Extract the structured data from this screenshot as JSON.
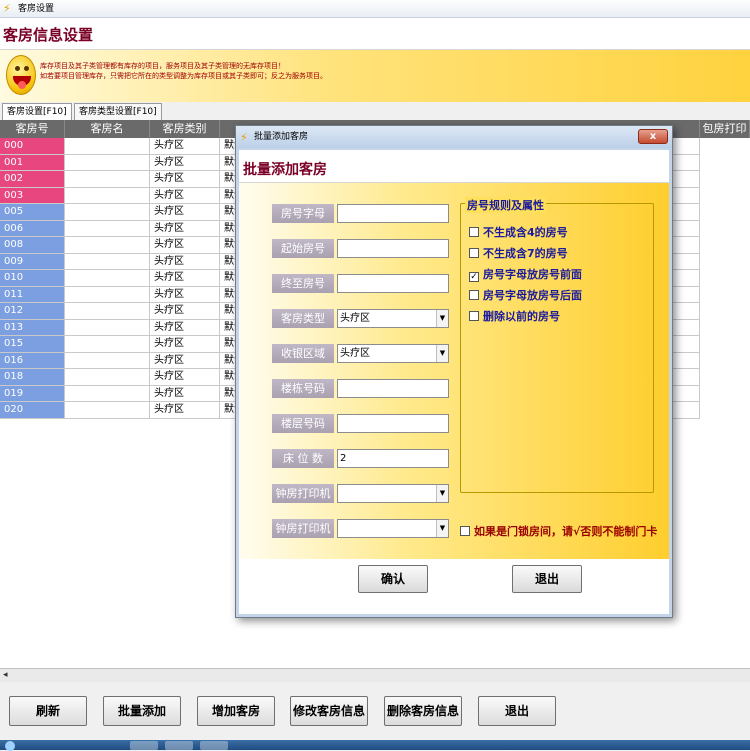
{
  "window": {
    "title": "客房设置"
  },
  "header": {
    "title": "客房信息设置"
  },
  "banner": {
    "tip_line1": "库存项目及其子类管理都有库存的项目，服务项目及其子类管理的无库存项目！",
    "tip_line2": "如若要项目管理库存，只需把它所在的类型调整为库存项目或其子类即可；反之为服务项目。"
  },
  "tabs": [
    {
      "label": "客房设置[F10]"
    },
    {
      "label": "客房类型设置[F10]"
    }
  ],
  "table": {
    "columns": [
      "客房号",
      "客房名",
      "客房类别",
      "",
      "包房打印"
    ],
    "rows": [
      {
        "num": "000",
        "name": "",
        "type": "头疗区",
        "extra": "默认",
        "color": "pink"
      },
      {
        "num": "001",
        "name": "",
        "type": "头疗区",
        "extra": "默认",
        "color": "pink"
      },
      {
        "num": "002",
        "name": "",
        "type": "头疗区",
        "extra": "默认",
        "color": "pink"
      },
      {
        "num": "003",
        "name": "",
        "type": "头疗区",
        "extra": "默认",
        "color": "pink"
      },
      {
        "num": "005",
        "name": "",
        "type": "头疗区",
        "extra": "默认",
        "color": "blue"
      },
      {
        "num": "006",
        "name": "",
        "type": "头疗区",
        "extra": "默认",
        "color": "blue"
      },
      {
        "num": "008",
        "name": "",
        "type": "头疗区",
        "extra": "默认",
        "color": "blue"
      },
      {
        "num": "009",
        "name": "",
        "type": "头疗区",
        "extra": "默认",
        "color": "blue"
      },
      {
        "num": "010",
        "name": "",
        "type": "头疗区",
        "extra": "默认",
        "color": "blue"
      },
      {
        "num": "011",
        "name": "",
        "type": "头疗区",
        "extra": "默认",
        "color": "blue"
      },
      {
        "num": "012",
        "name": "",
        "type": "头疗区",
        "extra": "默认",
        "color": "blue"
      },
      {
        "num": "013",
        "name": "",
        "type": "头疗区",
        "extra": "默认",
        "color": "blue"
      },
      {
        "num": "015",
        "name": "",
        "type": "头疗区",
        "extra": "默认",
        "color": "blue"
      },
      {
        "num": "016",
        "name": "",
        "type": "头疗区",
        "extra": "默认",
        "color": "blue"
      },
      {
        "num": "018",
        "name": "",
        "type": "头疗区",
        "extra": "默认",
        "color": "blue"
      },
      {
        "num": "019",
        "name": "",
        "type": "头疗区",
        "extra": "默认",
        "color": "blue"
      },
      {
        "num": "020",
        "name": "",
        "type": "头疗区",
        "extra": "默认",
        "color": "blue"
      }
    ]
  },
  "footer_buttons": [
    {
      "label": "刷新"
    },
    {
      "label": "批量添加"
    },
    {
      "label": "增加客房"
    },
    {
      "label": "修改客房信息"
    },
    {
      "label": "删除客房信息"
    },
    {
      "label": "退出"
    }
  ],
  "dialog": {
    "title": "批量添加客房",
    "header": "批量添加客房",
    "close_label": "x",
    "fields": [
      {
        "label": "房号字母",
        "value": "",
        "kind": "input"
      },
      {
        "label": "起始房号",
        "value": "",
        "kind": "input"
      },
      {
        "label": "终至房号",
        "value": "",
        "kind": "input"
      },
      {
        "label": "客房类型",
        "value": "头疗区",
        "kind": "select"
      },
      {
        "label": "收银区域",
        "value": "头疗区",
        "kind": "select"
      },
      {
        "label": "楼栋号码",
        "value": "",
        "kind": "input"
      },
      {
        "label": "楼层号码",
        "value": "",
        "kind": "input"
      },
      {
        "label": "床 位 数",
        "value": "2",
        "kind": "input"
      },
      {
        "label": "钟房打印机",
        "value": "",
        "kind": "select"
      },
      {
        "label": "钟房打印机",
        "value": "",
        "kind": "select"
      }
    ],
    "group_title": "房号规则及属性",
    "rules": [
      {
        "label": "不生成含4的房号",
        "checked": false
      },
      {
        "label": "不生成含7的房号",
        "checked": false
      },
      {
        "label": "房号字母放房号前面",
        "checked": true
      },
      {
        "label": "房号字母放房号后面",
        "checked": false
      },
      {
        "label": "删除以前的房号",
        "checked": false
      }
    ],
    "lock_note": "如果是门锁房间，请√否则不能制门卡",
    "ok_label": "确认",
    "cancel_label": "退出"
  },
  "colors": {
    "pink": "#e8467f",
    "blue": "#7b9fe0",
    "title_red": "#7a0026",
    "rule_blue": "#1a1aa0"
  }
}
